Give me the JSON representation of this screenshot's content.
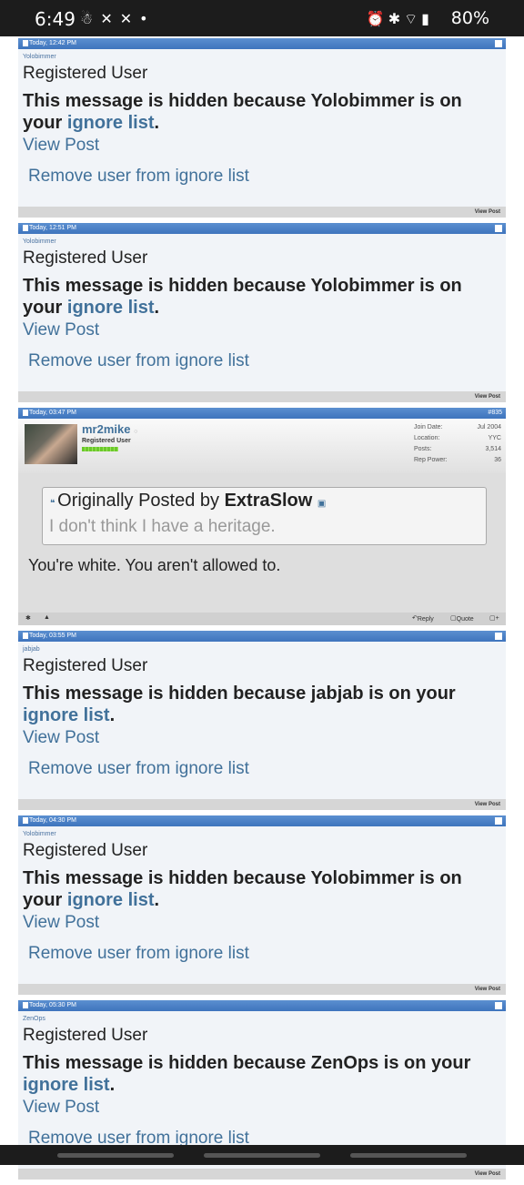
{
  "status_bar": {
    "time": "6:49",
    "battery": "80%"
  },
  "common": {
    "role": "Registered User",
    "view_post": "View Post",
    "remove": "Remove user from ignore list",
    "footer_view_post": "View Post",
    "hidden_prefix": "This message is hidden because ",
    "hidden_mid": " is on your ",
    "ignore_list": "ignore list",
    "period": "."
  },
  "posts": [
    {
      "date": "Today, 12:42 PM",
      "user": "Yolobimmer"
    },
    {
      "date": "Today, 12:51 PM",
      "user": "Yolobimmer"
    },
    {
      "date": "Today, 03:55 PM",
      "user": "jabjab"
    },
    {
      "date": "Today, 04:30 PM",
      "user": "Yolobimmer"
    },
    {
      "date": "Today, 05:30 PM",
      "user": "ZenOps"
    }
  ],
  "full_post": {
    "date": "Today,   03:47 PM",
    "number": "#835",
    "user": "mr2mike",
    "role": "Registered User",
    "stats": [
      {
        "label": "Join Date:",
        "value": "Jul 2004"
      },
      {
        "label": "Location:",
        "value": "YYC"
      },
      {
        "label": "Posts:",
        "value": "3,514"
      },
      {
        "label": "Rep Power:",
        "value": "36"
      }
    ],
    "quote_prefix": "Originally Posted by ",
    "quote_author": "ExtraSlow",
    "quote_text": "I don't think I have a heritage.",
    "message": "You're white. You aren't allowed to.",
    "reply": "Reply",
    "quote": "Quote"
  }
}
